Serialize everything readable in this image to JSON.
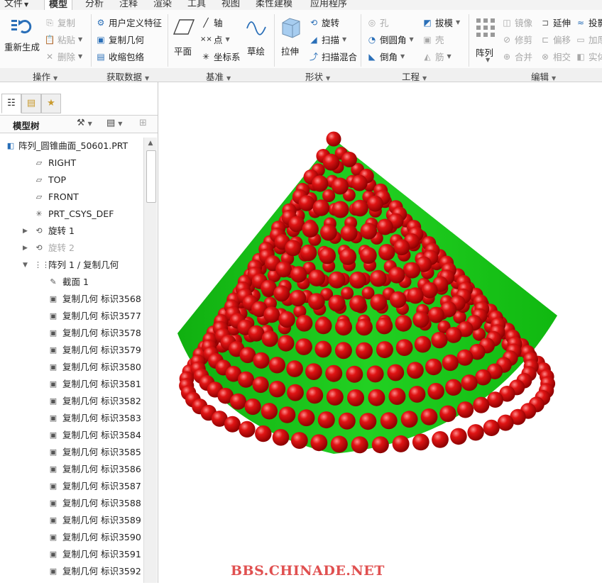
{
  "menu": {
    "file": "文件",
    "tabs": [
      "模型",
      "分析",
      "注释",
      "渲染",
      "工具",
      "视图",
      "柔性建模",
      "应用程序"
    ],
    "active_tab": "模型"
  },
  "ribbon": {
    "operations": {
      "regenerate": "重新生成",
      "copy": "复制",
      "paste": "粘贴",
      "delete": "删除",
      "group": "操作"
    },
    "get_data": {
      "udf": "用户定义特征",
      "copy_geometry": "复制几何",
      "shrinkwrap": "收缩包络",
      "group": "获取数据"
    },
    "datum": {
      "plane": "平面",
      "axis": "轴",
      "point": "点",
      "csys": "坐标系",
      "sketch": "草绘",
      "group": "基准"
    },
    "shapes": {
      "extrude": "拉伸",
      "revolve": "旋转",
      "sweep": "扫描",
      "swept_blend": "扫描混合",
      "group": "形状"
    },
    "engineering": {
      "hole": "孔",
      "round": "倒圆角",
      "chamfer": "倒角",
      "draft": "拔模",
      "shell": "壳",
      "rib": "筋",
      "group": "工程"
    },
    "editing": {
      "pattern": "阵列",
      "mirror": "镜像",
      "trim": "修剪",
      "merge": "合并",
      "extend": "延伸",
      "offset": "偏移",
      "intersect": "相交",
      "project": "投影",
      "thicken": "加厚",
      "solidify": "实体化",
      "group": "编辑"
    }
  },
  "model_tree": {
    "title": "模型树",
    "items": [
      {
        "label": "阵列_圆锥曲面_50601.PRT",
        "icon": "part-icon",
        "indent": 0,
        "expander": "",
        "dim": false
      },
      {
        "label": "RIGHT",
        "icon": "datum-plane-icon",
        "indent": 1,
        "expander": "",
        "dim": false
      },
      {
        "label": "TOP",
        "icon": "datum-plane-icon",
        "indent": 1,
        "expander": "",
        "dim": false
      },
      {
        "label": "FRONT",
        "icon": "datum-plane-icon",
        "indent": 1,
        "expander": "",
        "dim": false
      },
      {
        "label": "PRT_CSYS_DEF",
        "icon": "csys-icon",
        "indent": 1,
        "expander": "",
        "dim": false
      },
      {
        "label": "旋转 1",
        "icon": "revolve-icon",
        "indent": 1,
        "expander": "▶",
        "dim": false
      },
      {
        "label": "旋转 2",
        "icon": "revolve-icon",
        "indent": 1,
        "expander": "▶",
        "dim": true
      },
      {
        "label": "阵列 1 / 复制几何",
        "icon": "pattern-icon",
        "indent": 1,
        "expander": "▼",
        "dim": false
      },
      {
        "label": "截面 1",
        "icon": "sketch-icon",
        "indent": 2,
        "expander": "",
        "dim": false
      },
      {
        "label": "复制几何 标识3568",
        "icon": "copy-geometry-icon",
        "indent": 2,
        "expander": "",
        "dim": false
      },
      {
        "label": "复制几何 标识3577",
        "icon": "copy-geometry-icon",
        "indent": 2,
        "expander": "",
        "dim": false
      },
      {
        "label": "复制几何 标识3578",
        "icon": "copy-geometry-icon",
        "indent": 2,
        "expander": "",
        "dim": false
      },
      {
        "label": "复制几何 标识3579",
        "icon": "copy-geometry-icon",
        "indent": 2,
        "expander": "",
        "dim": false
      },
      {
        "label": "复制几何 标识3580",
        "icon": "copy-geometry-icon",
        "indent": 2,
        "expander": "",
        "dim": false
      },
      {
        "label": "复制几何 标识3581",
        "icon": "copy-geometry-icon",
        "indent": 2,
        "expander": "",
        "dim": false
      },
      {
        "label": "复制几何 标识3582",
        "icon": "copy-geometry-icon",
        "indent": 2,
        "expander": "",
        "dim": false
      },
      {
        "label": "复制几何 标识3583",
        "icon": "copy-geometry-icon",
        "indent": 2,
        "expander": "",
        "dim": false
      },
      {
        "label": "复制几何 标识3584",
        "icon": "copy-geometry-icon",
        "indent": 2,
        "expander": "",
        "dim": false
      },
      {
        "label": "复制几何 标识3585",
        "icon": "copy-geometry-icon",
        "indent": 2,
        "expander": "",
        "dim": false
      },
      {
        "label": "复制几何 标识3586",
        "icon": "copy-geometry-icon",
        "indent": 2,
        "expander": "",
        "dim": false
      },
      {
        "label": "复制几何 标识3587",
        "icon": "copy-geometry-icon",
        "indent": 2,
        "expander": "",
        "dim": false
      },
      {
        "label": "复制几何 标识3588",
        "icon": "copy-geometry-icon",
        "indent": 2,
        "expander": "",
        "dim": false
      },
      {
        "label": "复制几何 标识3589",
        "icon": "copy-geometry-icon",
        "indent": 2,
        "expander": "",
        "dim": false
      },
      {
        "label": "复制几何 标识3590",
        "icon": "copy-geometry-icon",
        "indent": 2,
        "expander": "",
        "dim": false
      },
      {
        "label": "复制几何 标识3591",
        "icon": "copy-geometry-icon",
        "indent": 2,
        "expander": "",
        "dim": false
      },
      {
        "label": "复制几何 标识3592",
        "icon": "copy-geometry-icon",
        "indent": 2,
        "expander": "",
        "dim": false
      }
    ]
  },
  "viewport": {
    "cone_color": "#1ec81e",
    "sphere_color": "#d41010"
  },
  "watermark": "BBS.CHINADE.NET"
}
